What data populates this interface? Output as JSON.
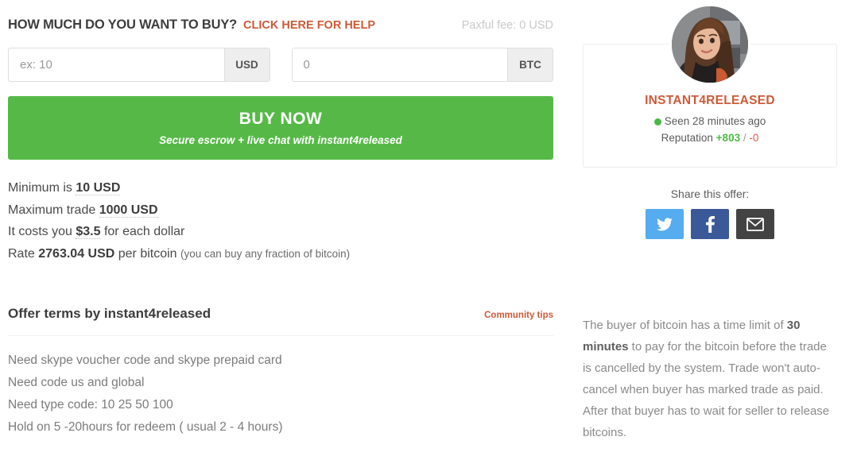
{
  "buy_section": {
    "title": "HOW MUCH DO YOU WANT TO BUY?",
    "help_link": "CLICK HERE FOR HELP",
    "fee_text": "Paxful fee: 0 USD",
    "fiat_input": {
      "placeholder": "ex: 10",
      "value": "",
      "addon": "USD"
    },
    "crypto_input": {
      "placeholder": "0",
      "value": "",
      "addon": "BTC"
    },
    "buy_button": {
      "title": "BUY NOW",
      "subtitle": "Secure escrow + live chat with instant4released"
    }
  },
  "details": {
    "minimum_prefix": "Minimum is ",
    "minimum_value": "10 USD",
    "maximum_prefix": "Maximum trade ",
    "maximum_value": "1000 USD",
    "cost_prefix": "It costs you ",
    "cost_value": "$3.5",
    "cost_suffix": " for each dollar",
    "rate_prefix": "Rate ",
    "rate_value": "2763.04 USD",
    "rate_suffix": " per bitcoin ",
    "rate_note": "(you can buy any fraction of bitcoin)"
  },
  "terms": {
    "title": "Offer terms by instant4released",
    "community_tips": "Community tips",
    "lines": [
      "Need skype voucher code and skype prepaid card",
      "Need code us and global",
      "Need type code: 10 25 50 100",
      "Hold on 5 -20hours for redeem ( usual 2 - 4 hours)"
    ]
  },
  "seller": {
    "username": "INSTANT4RELEASED",
    "seen_text": "Seen 28 minutes ago",
    "reputation_label": "Reputation ",
    "reputation_positive": "+803",
    "reputation_separator": " / ",
    "reputation_negative": "-0"
  },
  "share": {
    "label": "Share this offer:",
    "twitter": "twitter-icon",
    "facebook": "facebook-icon",
    "email": "email-icon"
  },
  "info_paragraph": {
    "part1": "The buyer of bitcoin has a time limit of ",
    "bold": "30 minutes",
    "part2": " to pay for the bitcoin before the trade is cancelled by the system. Trade won't auto-cancel when buyer has marked trade as paid. After that buyer has to wait for seller to release bitcoins."
  },
  "colors": {
    "accent_orange": "#cd5b37",
    "buy_green": "#56b947",
    "positive_green": "#4cb944",
    "negative_red": "#e2574c",
    "twitter_blue": "#55acee",
    "facebook_blue": "#3b5998",
    "email_gray": "#434343"
  }
}
